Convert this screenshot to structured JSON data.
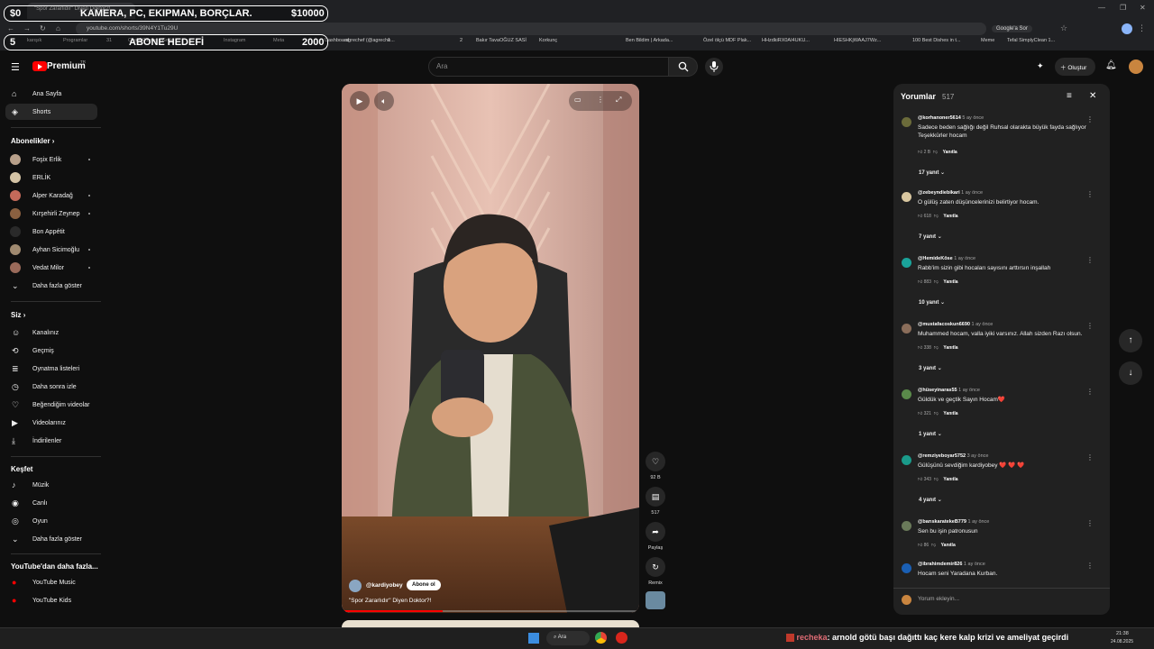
{
  "browser": {
    "tab_title": "\"Spor Zararlıdır\" Diyen Doktor?!",
    "url": "youtube.com/shorts/39N4Y1Tu29U",
    "google_label": "Google'a Sor",
    "bookmarks": [
      "karışık",
      "Programlar",
      "31",
      "ChatGPT",
      "konuş - Grok",
      "Instagram",
      "Meta",
      "Dashboard",
      "agrechef (@agreche...",
      "1",
      "2",
      "Bakır Tava",
      "OĞUZ SASİ",
      "Korkunç",
      "Ben Bildim | Arkada...",
      "Özel ölçü MDF Plak...",
      "HHzdkiRX0AI4UKU...",
      "HIESHKjWAAJ7Wz...",
      "100 Best Dishes in t...",
      "Meme",
      "Tefal SimplyClean 1..."
    ]
  },
  "overlay": {
    "row1_left": "$0",
    "row1_center": "KAMERA, PC, EKIPMAN, BORÇLAR.",
    "row1_right": "$10000",
    "row2_left": "5",
    "row2_center": "ABONE HEDEFİ",
    "row2_right": "2000"
  },
  "header": {
    "logo": "Premium",
    "logo_sup": "TR",
    "search_placeholder": "Ara",
    "create_label": "Oluştur"
  },
  "sidebar": {
    "main": [
      {
        "label": "Ana Sayfa",
        "icon": "home-icon"
      },
      {
        "label": "Shorts",
        "icon": "shorts-icon"
      }
    ],
    "subs_title": "Abonelikler",
    "subs": [
      "Foşix Erlik",
      "ERLİK",
      "Alper Karadağ",
      "Kırşehirli Zeynep",
      "Bon Appétit",
      "Ayhan Sicimoğlu",
      "Vedat Milor"
    ],
    "subs_more": "Daha fazla göster",
    "you_title": "Siz",
    "you": [
      "Kanalınız",
      "Geçmiş",
      "Oynatma listeleri",
      "Daha sonra izle",
      "Beğendiğim videolar",
      "Videolarınız",
      "İndirilenler"
    ],
    "explore_title": "Keşfet",
    "explore": [
      "Müzik",
      "Canlı",
      "Oyun"
    ],
    "explore_more": "Daha fazla göster",
    "more_title": "YouTube'dan daha fazla...",
    "more": [
      "YouTube Music",
      "YouTube Kids"
    ]
  },
  "video": {
    "channel": "@kardiyobey",
    "subscribe": "Abone ol",
    "title": "\"Spor Zararlıdır\" Diyen Doktor?!",
    "progress": 0.34
  },
  "actions": {
    "likes": "92 B",
    "comments": "517",
    "share": "Paylaş",
    "remix": "Remix"
  },
  "comments_panel": {
    "title": "Yorumlar",
    "count": "517",
    "add_placeholder": "Yorum ekleyin...",
    "reply_label": "Yanıtla",
    "items": [
      {
        "user": "@korhanoner5614",
        "time": "5 ay önce",
        "text": "Sadece beden sağlığı değil Ruhsal olarakta büyük fayda sağlıyor Teşekkürler hocam",
        "likes": "2 B",
        "replies": "17 yanıt",
        "color": "#6b6b3a"
      },
      {
        "user": "@zebeyndiebikari",
        "time": "1 ay önce",
        "text": "O gülüş zaten düşüncelerinizi belirtiyor hocam.",
        "likes": "618",
        "replies": "7 yanıt",
        "color": "#d9c7a0"
      },
      {
        "user": "@HemideKöse",
        "time": "1 ay önce",
        "text": "Rabb'im sizin gibi hocaları sayısını arttırsın inşallah",
        "likes": "883",
        "replies": "10 yanıt",
        "color": "#1aa39a"
      },
      {
        "user": "@mustafacoskun6690",
        "time": "1 ay önce",
        "text": "Muhammed hocam, valla iyiki varsınız. Allah sizden Razı olsun.",
        "likes": "338",
        "replies": "3 yanıt",
        "color": "#8a6d5a"
      },
      {
        "user": "@hüseyinaras55",
        "time": "1 ay önce",
        "text": "Güldük ve geçtik Sayın Hocam❤️",
        "likes": "321",
        "replies": "1 yanıt",
        "color": "#5a8a4a"
      },
      {
        "user": "@remziyeboyar5752",
        "time": "3 ay önce",
        "text": "Gülüşünü sevdiğim kardiyobey ❤️ ❤️ ❤️",
        "likes": "343",
        "replies": "4 yanıt",
        "color": "#1a9a8a"
      },
      {
        "user": "@barıskaratekeB779",
        "time": "1 ay önce",
        "text": "Sen bu işin patronusun",
        "likes": "86",
        "replies": "",
        "color": "#6a7a5a"
      },
      {
        "user": "@ibrahimdemir826",
        "time": "1 ay önce",
        "text": "Hocam seni Yaradana Kurban.",
        "likes": "",
        "replies": "",
        "color": "#1a5fb4"
      }
    ]
  },
  "taskbar": {
    "search": "Ara",
    "ticker_user": "recheka",
    "ticker_text": ": arnold götü başı dağıttı kaç kere kalp krizi ve ameliyat geçirdi",
    "time": "21:38",
    "date": "24.08.2025"
  },
  "colors": {
    "accent": "#ff0000",
    "bg": "#0f0f0f",
    "panel": "#212121"
  }
}
